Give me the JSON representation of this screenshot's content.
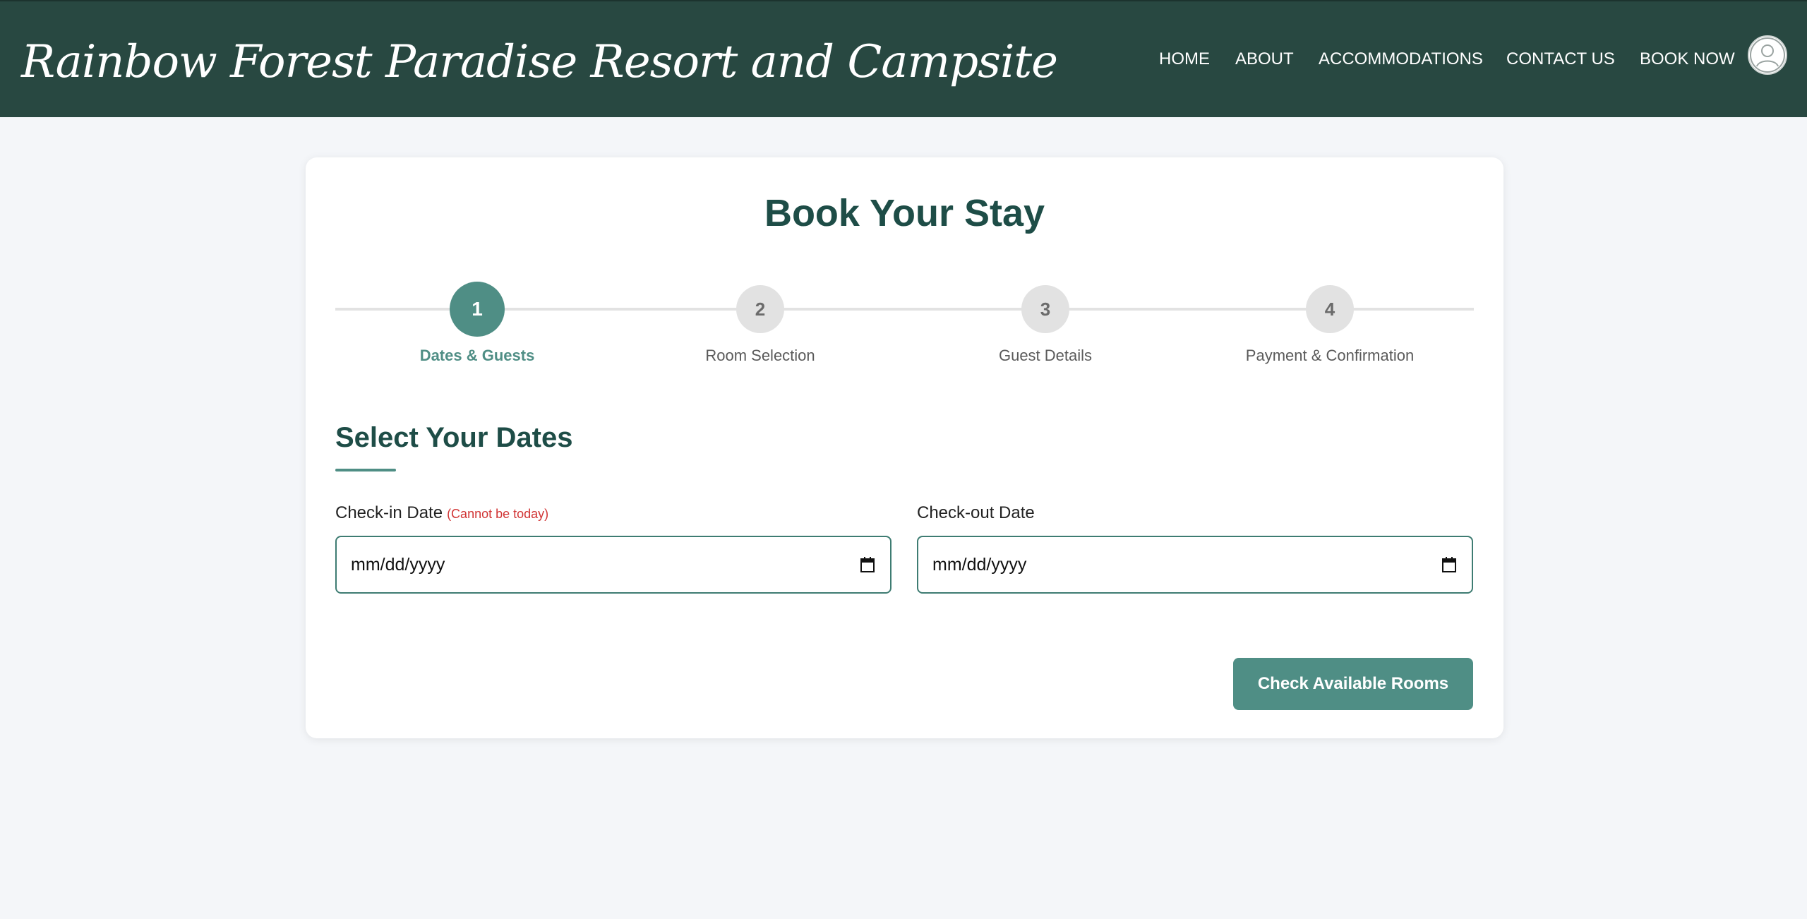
{
  "header": {
    "brand": "Rainbow Forest Paradise Resort and Campsite",
    "nav": {
      "home": "HOME",
      "about": "ABOUT",
      "accommodations": "ACCOMMODATIONS",
      "contact": "CONTACT US",
      "book": "BOOK NOW"
    },
    "avatar_icon": "user-circle-icon"
  },
  "booking": {
    "title": "Book Your Stay",
    "steps": [
      {
        "number": "1",
        "label": "Dates & Guests",
        "active": true
      },
      {
        "number": "2",
        "label": "Room Selection",
        "active": false
      },
      {
        "number": "3",
        "label": "Guest Details",
        "active": false
      },
      {
        "number": "4",
        "label": "Payment & Confirmation",
        "active": false
      }
    ],
    "section_title": "Select Your Dates",
    "checkin": {
      "label": "Check-in Date",
      "note": "(Cannot be today)",
      "placeholder": "mm/dd/yyyy",
      "icon": "calendar-icon"
    },
    "checkout": {
      "label": "Check-out Date",
      "placeholder": "mm/dd/yyyy",
      "icon": "calendar-icon"
    },
    "submit_label": "Check Available Rooms"
  },
  "colors": {
    "header_bg": "#284841",
    "accent": "#4f8e85",
    "title": "#1e4d47",
    "page_bg": "#f4f6f9",
    "error": "#d13434"
  }
}
